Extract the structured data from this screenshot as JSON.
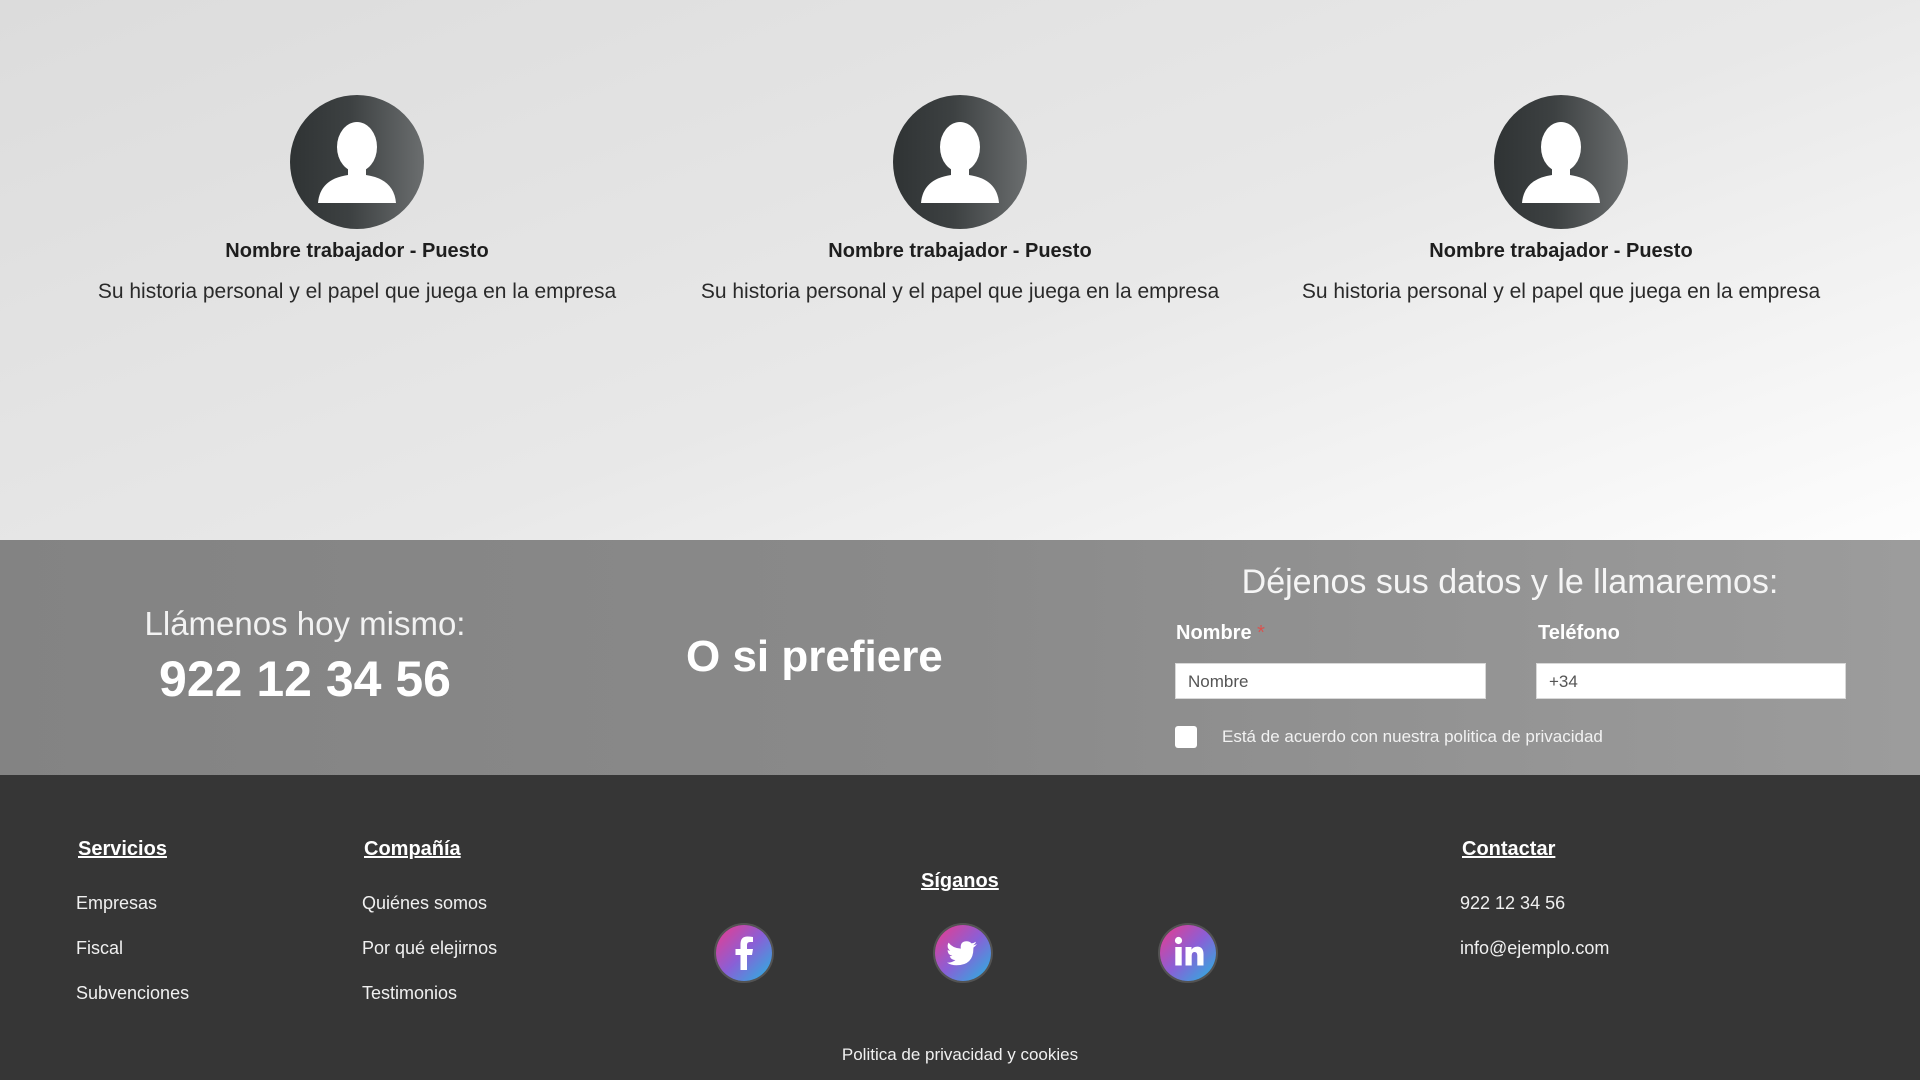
{
  "team": {
    "members": [
      {
        "name": "Nombre trabajador -  Puesto",
        "bio": "Su historia personal y el papel que juega en la empresa"
      },
      {
        "name": "Nombre trabajador -  Puesto",
        "bio": "Su historia personal y el papel que juega en la empresa"
      },
      {
        "name": "Nombre trabajador -  Puesto",
        "bio": "Su historia personal y el papel que juega en la empresa"
      }
    ]
  },
  "callback": {
    "call_lead": "Llámenos hoy mismo:",
    "phone": "922 12 34 56",
    "or_text": "O si prefiere",
    "form_title": "Déjenos sus datos y le llamaremos:",
    "name_label": "Nombre",
    "required_mark": "*",
    "name_placeholder": "Nombre",
    "phone_label": "Teléfono",
    "phone_value": "+34",
    "privacy_label": "Está de acuerdo con nuestra politica de privacidad"
  },
  "footer": {
    "servicios": {
      "title": "Servicios",
      "items": [
        "Empresas",
        "Fiscal",
        "Subvenciones"
      ]
    },
    "compania": {
      "title": "Compañía",
      "items": [
        "Quiénes somos",
        "Por qué elejirnos",
        "Testimonios"
      ]
    },
    "siganos": {
      "title": "Síganos",
      "icons": [
        "facebook-icon",
        "twitter-icon",
        "linkedin-icon"
      ]
    },
    "contactar": {
      "title": "Contactar",
      "phone": "922 12 34 56",
      "email": "info@ejemplo.com"
    },
    "legal": "Politica de privacidad y cookies"
  },
  "colors": {
    "footer_bg": "#363636",
    "band_bg": "#8a8a8a",
    "social_gradient": [
      "#ec3a8b",
      "#8a5fd6",
      "#23b7e0"
    ],
    "required": "#d9534f"
  }
}
